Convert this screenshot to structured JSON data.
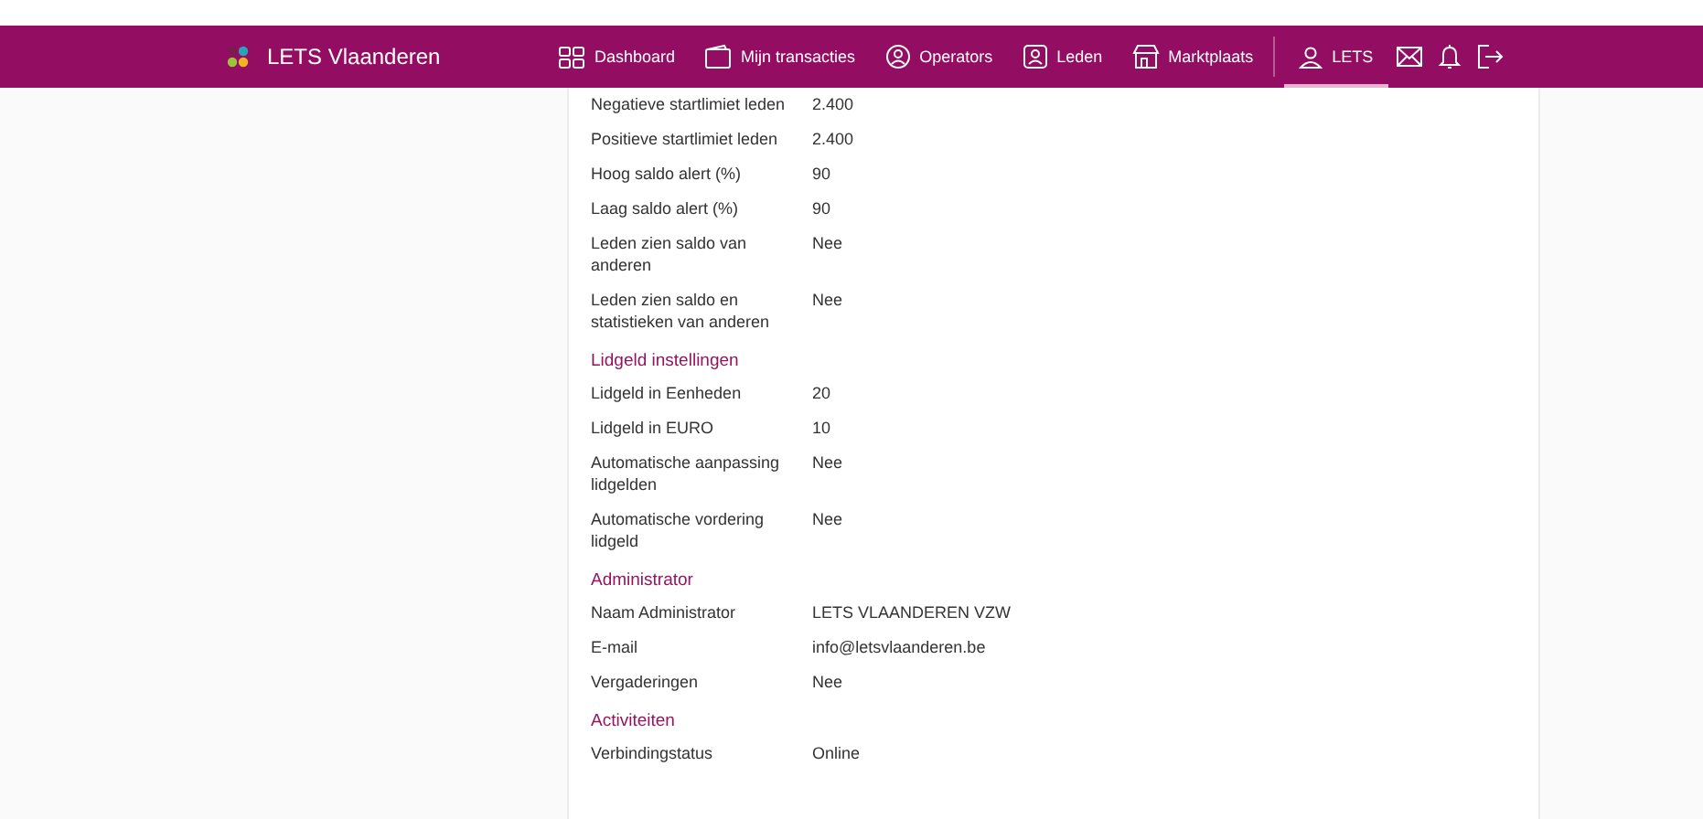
{
  "brand": {
    "name": "LETS Vlaanderen"
  },
  "nav": [
    {
      "label": "Dashboard",
      "kind": "grid",
      "selected": false
    },
    {
      "label": "Mijn transacties",
      "kind": "wallet",
      "selected": false
    },
    {
      "label": "Operators",
      "kind": "operators",
      "selected": false
    },
    {
      "label": "Leden",
      "kind": "members",
      "selected": false
    },
    {
      "label": "Marktplaats",
      "kind": "shop",
      "selected": false
    }
  ],
  "user_menu": {
    "label": "LETS",
    "selected": true
  },
  "sections": [
    {
      "rows": [
        {
          "label": "Negatieve startlimiet leden",
          "value": "2.400"
        },
        {
          "label": "Positieve startlimiet leden",
          "value": "2.400"
        },
        {
          "label": "Hoog saldo alert (%)",
          "value": "90"
        },
        {
          "label": "Laag saldo alert (%)",
          "value": "90"
        },
        {
          "label": "Leden zien saldo van anderen",
          "value": "Nee"
        },
        {
          "label": "Leden zien saldo en statistieken van anderen",
          "value": "Nee"
        }
      ]
    },
    {
      "title": "Lidgeld instellingen",
      "rows": [
        {
          "label": "Lidgeld in Eenheden",
          "value": "20"
        },
        {
          "label": "Lidgeld in EURO",
          "value": "10"
        },
        {
          "label": "Automatische aanpassing lidgelden",
          "value": "Nee"
        },
        {
          "label": "Automatische vordering lidgeld",
          "value": "Nee"
        }
      ]
    },
    {
      "title": "Administrator",
      "rows": [
        {
          "label": "Naam Administrator",
          "value": "LETS VLAANDEREN VZW"
        },
        {
          "label": "E-mail",
          "value": "info@letsvlaanderen.be"
        },
        {
          "label": "Vergaderingen",
          "value": "Nee"
        }
      ]
    },
    {
      "title": "Activiteiten",
      "rows": [
        {
          "label": "Verbindingstatus",
          "value": "Online"
        }
      ]
    }
  ]
}
